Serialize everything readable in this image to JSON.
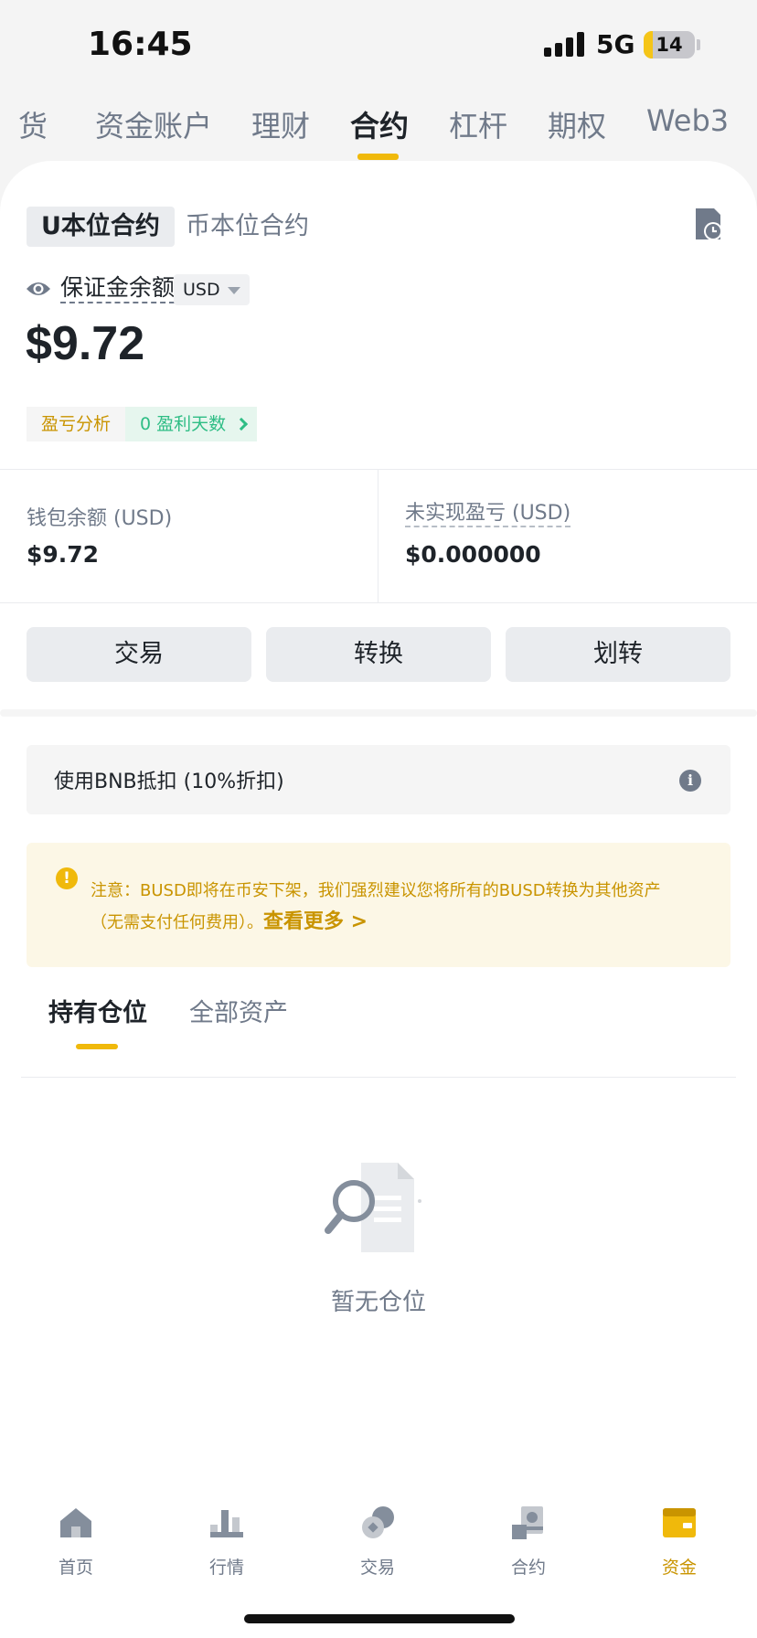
{
  "status_bar": {
    "time": "16:45",
    "network": "5G",
    "battery": "14"
  },
  "top_tabs": [
    {
      "label": "现货",
      "display": "货"
    },
    {
      "label": "资金账户"
    },
    {
      "label": "理财"
    },
    {
      "label": "合约",
      "active": true
    },
    {
      "label": "杠杆"
    },
    {
      "label": "期权"
    },
    {
      "label": "Web3"
    }
  ],
  "contract_type": {
    "active": "U本位合约",
    "inactive": "币本位合约"
  },
  "margin": {
    "label": "保证金余额",
    "currency": "USD",
    "balance": "$9.72"
  },
  "pnl": {
    "analysis_label": "盈亏分析",
    "profit_days": "0 盈利天数"
  },
  "stats": {
    "wallet_label": "钱包余额 (USD)",
    "wallet_value": "$9.72",
    "unrealized_label": "未实现盈亏 (USD)",
    "unrealized_value": "$0.000000"
  },
  "actions": {
    "trade": "交易",
    "convert": "转换",
    "transfer": "划转"
  },
  "bnb_discount": {
    "label": "使用BNB抵扣 (10%折扣)"
  },
  "notice": {
    "line1": "注意：BUSD即将在币安下架，我们强烈建议您将所有的BUSD转换为其他资产",
    "line2": "（无需支付任何费用）。",
    "link": "查看更多 >"
  },
  "sub_tabs": {
    "positions": "持有仓位",
    "assets": "全部资产"
  },
  "empty_state": {
    "text": "暂无仓位"
  },
  "bottom_nav": {
    "home": "首页",
    "markets": "行情",
    "trade": "交易",
    "futures": "合约",
    "wallet": "资金"
  },
  "colors": {
    "accent": "#f0b90b",
    "accent_text": "#c99400",
    "positive": "#2ebd85",
    "text_primary": "#1e2329",
    "text_secondary": "#707a8a"
  }
}
